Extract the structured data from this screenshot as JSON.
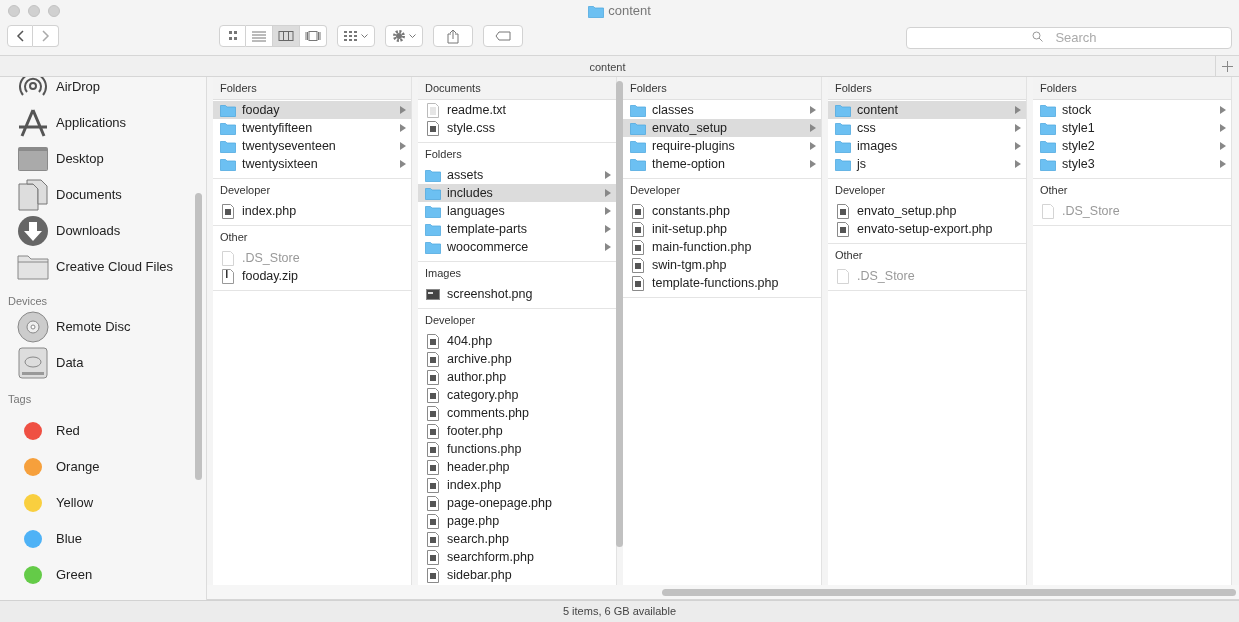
{
  "window": {
    "title": "content"
  },
  "toolbar": {
    "view_modes": [
      {
        "selected": false
      },
      {
        "selected": false
      },
      {
        "selected": true
      },
      {
        "selected": false
      }
    ]
  },
  "search": {
    "placeholder": "Search"
  },
  "path_bar": {
    "title": "content"
  },
  "sidebar": {
    "favorites": [
      "AirDrop",
      "Applications",
      "Desktop",
      "Documents",
      "Downloads",
      "Creative Cloud Files"
    ],
    "devices": {
      "heading": "Devices",
      "items": [
        "Remote Disc",
        "Data"
      ]
    },
    "tags": {
      "heading": "Tags",
      "items": [
        {
          "label": "Red",
          "color": "#ef5043"
        },
        {
          "label": "Orange",
          "color": "#f6a03c"
        },
        {
          "label": "Yellow",
          "color": "#f9cf3f"
        },
        {
          "label": "Blue",
          "color": "#4eb2f6"
        },
        {
          "label": "Green",
          "color": "#64cb48"
        }
      ]
    }
  },
  "columns": [
    {
      "sections": [
        {
          "title": "Folders",
          "items": [
            {
              "name": "fooday",
              "kind": "folder",
              "selected": true
            },
            {
              "name": "twentyfifteen",
              "kind": "folder",
              "selected": false
            },
            {
              "name": "twentyseventeen",
              "kind": "folder",
              "selected": false
            },
            {
              "name": "twentysixteen",
              "kind": "folder",
              "selected": false
            }
          ]
        },
        {
          "title": "Developer",
          "items": [
            {
              "name": "index.php",
              "kind": "code",
              "selected": false
            }
          ]
        },
        {
          "title": "Other",
          "items": [
            {
              "name": ".DS_Store",
              "kind": "hidden",
              "selected": false
            },
            {
              "name": "fooday.zip",
              "kind": "zip",
              "selected": false
            }
          ]
        }
      ]
    },
    {
      "sections": [
        {
          "title": "Documents",
          "items": [
            {
              "name": "readme.txt",
              "kind": "text",
              "selected": false
            },
            {
              "name": "style.css",
              "kind": "code",
              "selected": false
            }
          ]
        },
        {
          "title": "Folders",
          "items": [
            {
              "name": "assets",
              "kind": "folder",
              "selected": false
            },
            {
              "name": "includes",
              "kind": "folder",
              "selected": true
            },
            {
              "name": "languages",
              "kind": "folder",
              "selected": false
            },
            {
              "name": "template-parts",
              "kind": "folder",
              "selected": false
            },
            {
              "name": "woocommerce",
              "kind": "folder",
              "selected": false
            }
          ]
        },
        {
          "title": "Images",
          "items": [
            {
              "name": "screenshot.png",
              "kind": "image",
              "selected": false
            }
          ]
        },
        {
          "title": "Developer",
          "items": [
            {
              "name": "404.php",
              "kind": "code",
              "selected": false
            },
            {
              "name": "archive.php",
              "kind": "code",
              "selected": false
            },
            {
              "name": "author.php",
              "kind": "code",
              "selected": false
            },
            {
              "name": "category.php",
              "kind": "code",
              "selected": false
            },
            {
              "name": "comments.php",
              "kind": "code",
              "selected": false
            },
            {
              "name": "footer.php",
              "kind": "code",
              "selected": false
            },
            {
              "name": "functions.php",
              "kind": "code",
              "selected": false
            },
            {
              "name": "header.php",
              "kind": "code",
              "selected": false
            },
            {
              "name": "index.php",
              "kind": "code",
              "selected": false
            },
            {
              "name": "page-onepage.php",
              "kind": "code",
              "selected": false
            },
            {
              "name": "page.php",
              "kind": "code",
              "selected": false
            },
            {
              "name": "search.php",
              "kind": "code",
              "selected": false
            },
            {
              "name": "searchform.php",
              "kind": "code",
              "selected": false
            },
            {
              "name": "sidebar.php",
              "kind": "code",
              "selected": false
            }
          ]
        }
      ]
    },
    {
      "sections": [
        {
          "title": "Folders",
          "items": [
            {
              "name": "classes",
              "kind": "folder",
              "selected": false
            },
            {
              "name": "envato_setup",
              "kind": "folder",
              "selected": true
            },
            {
              "name": "require-plugins",
              "kind": "folder",
              "selected": false
            },
            {
              "name": "theme-option",
              "kind": "folder",
              "selected": false
            }
          ]
        },
        {
          "title": "Developer",
          "items": [
            {
              "name": "constants.php",
              "kind": "code",
              "selected": false
            },
            {
              "name": "init-setup.php",
              "kind": "code",
              "selected": false
            },
            {
              "name": "main-function.php",
              "kind": "code",
              "selected": false
            },
            {
              "name": "swin-tgm.php",
              "kind": "code",
              "selected": false
            },
            {
              "name": "template-functions.php",
              "kind": "code",
              "selected": false
            }
          ]
        }
      ]
    },
    {
      "sections": [
        {
          "title": "Folders",
          "items": [
            {
              "name": "content",
              "kind": "folder",
              "selected": true
            },
            {
              "name": "css",
              "kind": "folder",
              "selected": false
            },
            {
              "name": "images",
              "kind": "folder",
              "selected": false
            },
            {
              "name": "js",
              "kind": "folder",
              "selected": false
            }
          ]
        },
        {
          "title": "Developer",
          "items": [
            {
              "name": "envato_setup.php",
              "kind": "code",
              "selected": false
            },
            {
              "name": "envato-setup-export.php",
              "kind": "code",
              "selected": false
            }
          ]
        },
        {
          "title": "Other",
          "items": [
            {
              "name": ".DS_Store",
              "kind": "hidden",
              "selected": false
            }
          ]
        }
      ]
    },
    {
      "sections": [
        {
          "title": "Folders",
          "items": [
            {
              "name": "stock",
              "kind": "folder",
              "selected": false
            },
            {
              "name": "style1",
              "kind": "folder",
              "selected": false
            },
            {
              "name": "style2",
              "kind": "folder",
              "selected": false
            },
            {
              "name": "style3",
              "kind": "folder",
              "selected": false
            }
          ]
        },
        {
          "title": "Other",
          "items": [
            {
              "name": ".DS_Store",
              "kind": "hidden",
              "selected": false
            }
          ]
        }
      ]
    }
  ],
  "status_bar": {
    "text": "5 items, 6 GB available"
  }
}
